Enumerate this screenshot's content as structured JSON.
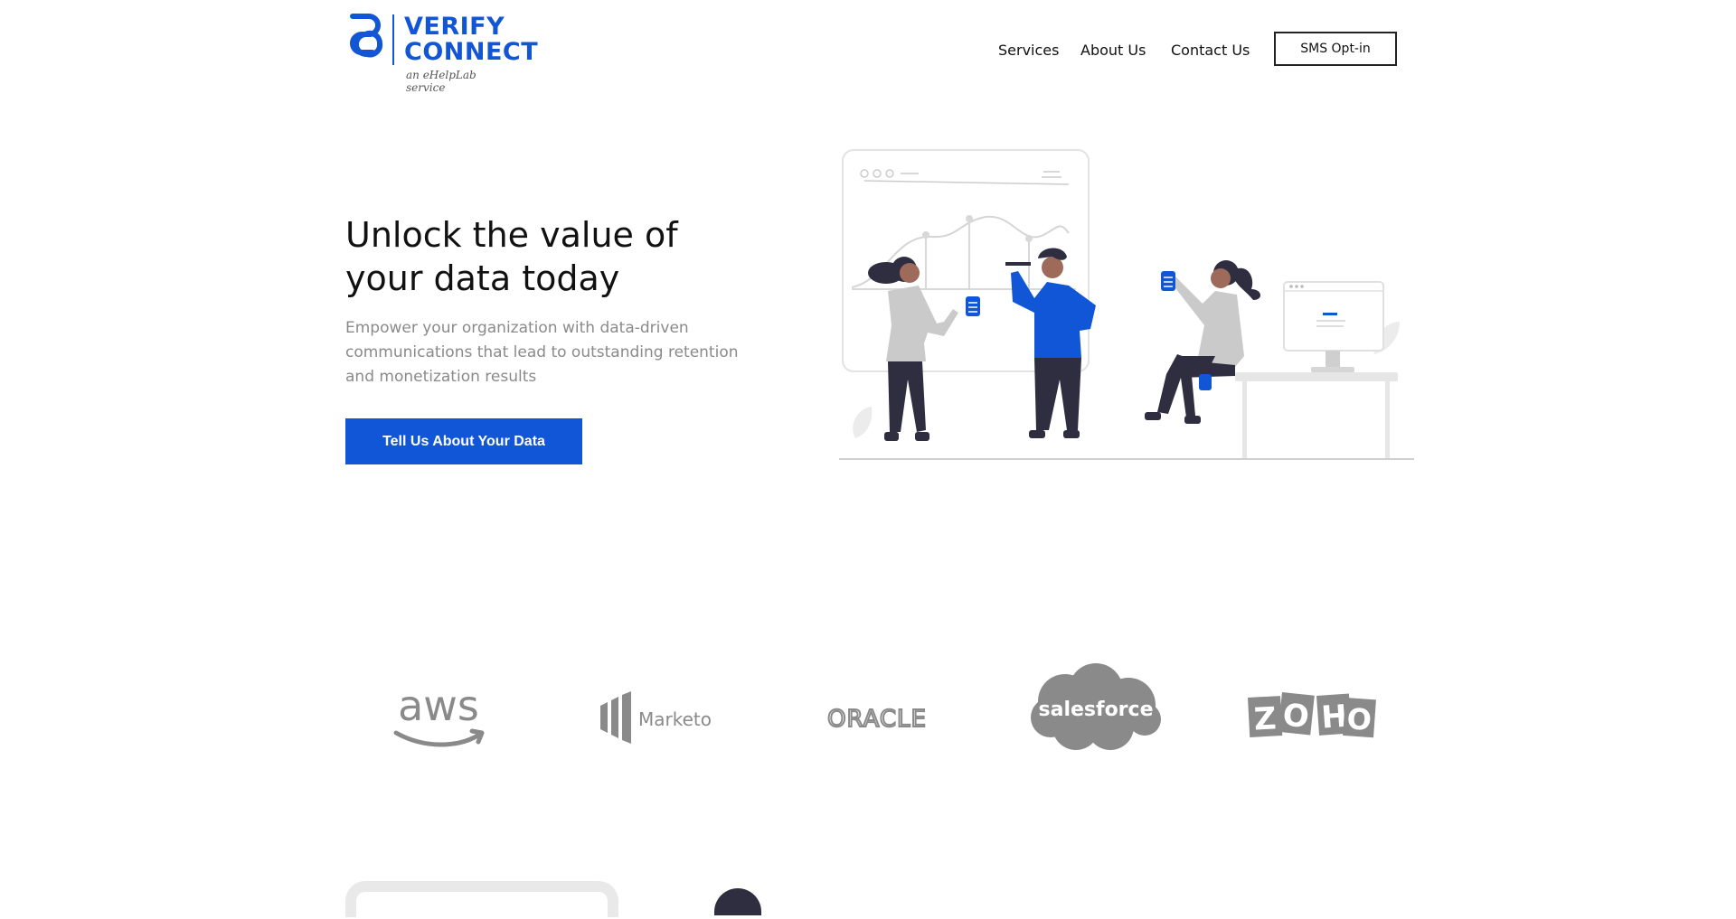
{
  "brand": {
    "line1": "VERIFY",
    "line2": "CONNECT",
    "tagline": "an eHelpLab service",
    "color": "#1256d6"
  },
  "nav": {
    "items": [
      "Services",
      "About Us",
      "Contact Us"
    ],
    "cta": "SMS Opt-in"
  },
  "hero": {
    "title_line1": "Unlock the value of",
    "title_line2": "your data today",
    "subtitle": "Empower your organization with data-driven communications that lead to outstanding retention and monetization results",
    "cta": "Tell Us About Your Data",
    "accent": "#1156d6"
  },
  "partners": {
    "aws": "aws",
    "marketo": "Marketo",
    "oracle": "ORACLE",
    "salesforce": "salesforce",
    "zoho": [
      "Z",
      "O",
      "H",
      "O"
    ]
  },
  "icons": {
    "logo_mark": "linked-chain-logo-icon",
    "illustration": "team-data-illustration"
  }
}
